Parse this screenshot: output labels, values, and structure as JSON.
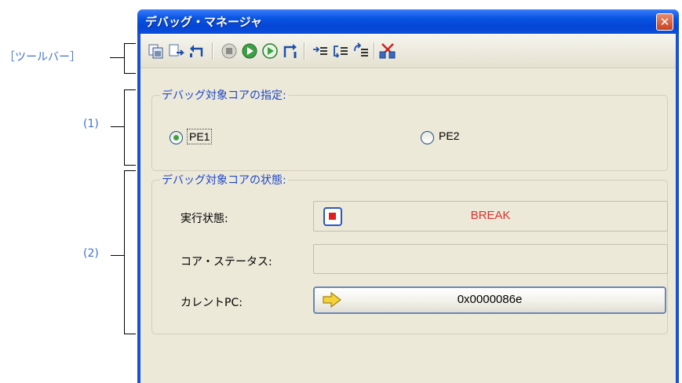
{
  "annotations": {
    "toolbar": "［ツールバー］",
    "group1": "(1)",
    "group2": "(2)"
  },
  "window": {
    "title": "デバッグ・マネージャ",
    "close_glyph": "✕"
  },
  "toolbar": {
    "buttons": [
      "clone-icon",
      "step-in-icon",
      "return-icon",
      "stop-icon",
      "run-icon",
      "run-from-icon",
      "step-return-icon",
      "step-over-icon",
      "step-into-line-icon",
      "step-out-line-icon",
      "break-pair-icon"
    ]
  },
  "core_select": {
    "label": "デバッグ対象コアの指定:",
    "options": [
      {
        "label": "PE1",
        "selected": true
      },
      {
        "label": "PE2",
        "selected": false
      }
    ]
  },
  "core_status": {
    "label": "デバッグ対象コアの状態:",
    "exec_state_label": "実行状態:",
    "exec_state_value": "BREAK",
    "exec_state_color": "#e03030",
    "core_status_label": "コア・ステータス:",
    "core_status_value": "",
    "current_pc_label": "カレントPC:",
    "current_pc_value": "0x0000086e"
  },
  "colors": {
    "title_bar": "#0a55e3",
    "annotation": "#3f6fd6",
    "group_label": "#1f46c9",
    "break_text": "#e03030"
  }
}
